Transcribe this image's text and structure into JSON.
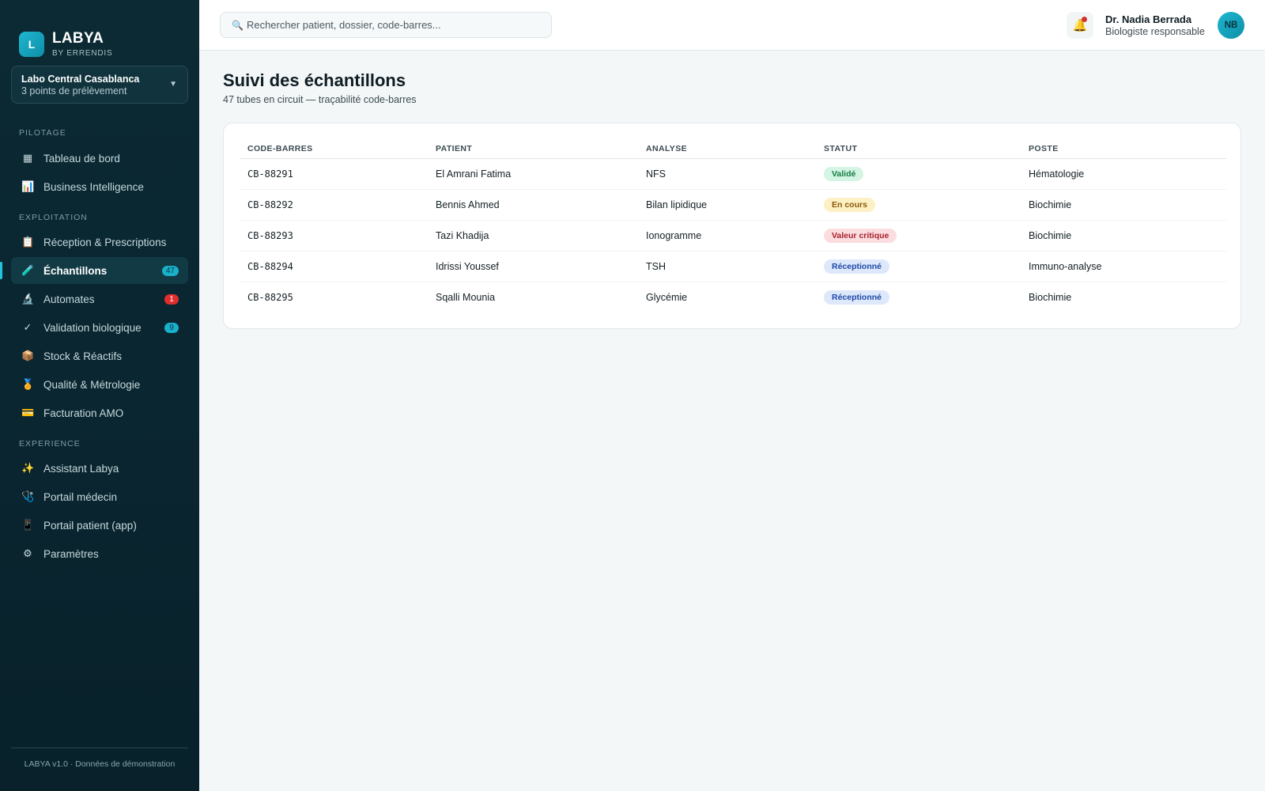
{
  "brand": {
    "logo_letter": "L",
    "name": "LABYA",
    "sub": "BY ERRENDIS"
  },
  "lab": {
    "name": "Labo Central Casablanca",
    "sub": "3 points de prélèvement"
  },
  "nav": {
    "sections": [
      "PILOTAGE",
      "EXPLOITATION",
      "EXPERIENCE"
    ],
    "items": [
      {
        "label": "Tableau de bord",
        "icon": "grid-icon"
      },
      {
        "label": "Business Intelligence",
        "icon": "chart-icon"
      },
      {
        "label": "Réception & Prescriptions",
        "icon": "clipboard-icon"
      },
      {
        "label": "Échantillons",
        "icon": "test-tube-icon",
        "badge": "47",
        "active": true
      },
      {
        "label": "Automates",
        "icon": "microscope-icon",
        "badge": "1"
      },
      {
        "label": "Validation biologique",
        "icon": "check-icon",
        "badge": "9"
      },
      {
        "label": "Stock & Réactifs",
        "icon": "box-icon"
      },
      {
        "label": "Qualité & Métrologie",
        "icon": "medal-icon"
      },
      {
        "label": "Facturation AMO",
        "icon": "card-icon"
      },
      {
        "label": "Assistant Labya",
        "icon": "sparkles-icon"
      },
      {
        "label": "Portail médecin",
        "icon": "stethoscope-icon"
      },
      {
        "label": "Portail patient (app)",
        "icon": "phone-icon"
      },
      {
        "label": "Paramètres",
        "icon": "gear-icon"
      }
    ]
  },
  "footer": "LABYA v1.0 · Données de démonstration",
  "search": {
    "placeholder": "Rechercher patient, dossier, code-barres..."
  },
  "user": {
    "name": "Dr. Nadia Berrada",
    "role": "Biologiste responsable",
    "initials": "NB"
  },
  "page": {
    "title": "Suivi des échantillons",
    "subtitle": "47 tubes en circuit — traçabilité code-barres"
  },
  "table": {
    "headers": [
      "CODE-BARRES",
      "PATIENT",
      "ANALYSE",
      "STATUT",
      "POSTE"
    ],
    "rows": [
      {
        "code": "CB-88291",
        "patient": "El Amrani Fatima",
        "analyse": "NFS",
        "statut": "Validé",
        "poste": "Hématologie"
      },
      {
        "code": "CB-88292",
        "patient": "Bennis Ahmed",
        "analyse": "Bilan lipidique",
        "statut": "En cours",
        "poste": "Biochimie"
      },
      {
        "code": "CB-88293",
        "patient": "Tazi Khadija",
        "analyse": "Ionogramme",
        "statut": "Valeur critique",
        "poste": "Biochimie"
      },
      {
        "code": "CB-88294",
        "patient": "Idrissi Youssef",
        "analyse": "TSH",
        "statut": "Réceptionné",
        "poste": "Immuno-analyse"
      },
      {
        "code": "CB-88295",
        "patient": "Sqalli Mounia",
        "analyse": "Glycémie",
        "statut": "Réceptionné",
        "poste": "Biochimie"
      }
    ]
  },
  "colors": {
    "accent": "#1ab0c9",
    "sidebar_bg": "#0b2a33",
    "danger": "#e02d2d",
    "success": "#147a44"
  }
}
